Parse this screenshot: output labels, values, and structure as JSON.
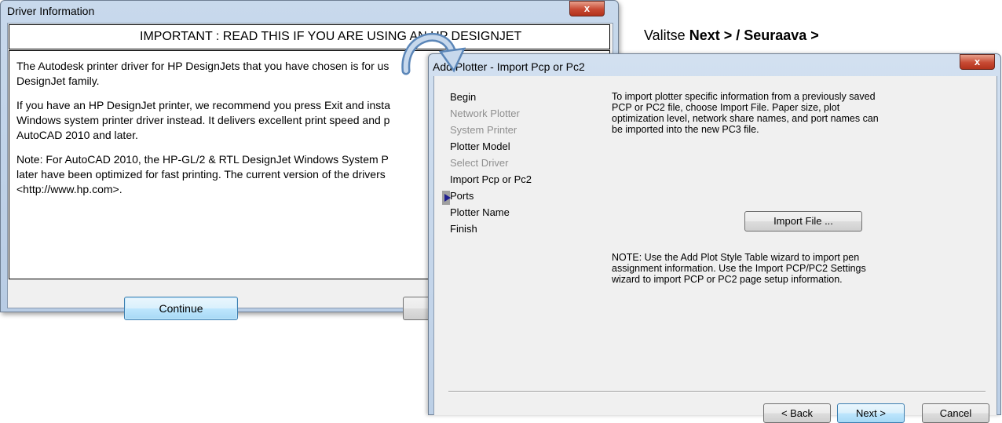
{
  "driver_window": {
    "title": "Driver Information",
    "close_label": "x",
    "header": "IMPORTANT : READ THIS IF YOU ARE USING AN HP DESIGNJET",
    "paragraphs": [
      "The Autodesk printer driver for HP DesignJets that you have chosen is for us\nDesignJet family.",
      "If you have an HP DesignJet printer, we recommend you press Exit and insta\nWindows system printer driver instead.  It delivers excellent print speed and p\nAutoCAD 2010 and later.",
      "Note: For AutoCAD 2010, the HP-GL/2 & RTL DesignJet Windows System P\nlater have been optimized for fast printing.  The current version of the drivers\n<http://www.hp.com>."
    ],
    "continue_label": "Continue"
  },
  "caption": {
    "prefix": "Valitse ",
    "bold": "Next > / Seuraava >"
  },
  "plotter_window": {
    "title": "Add Plotter - Import Pcp or Pc2",
    "close_label": "x",
    "steps": [
      {
        "label": "Begin",
        "enabled": true
      },
      {
        "label": "Network Plotter",
        "enabled": false
      },
      {
        "label": "System Printer",
        "enabled": false
      },
      {
        "label": "Plotter Model",
        "enabled": true
      },
      {
        "label": "Select Driver",
        "enabled": false
      },
      {
        "label": "Import Pcp or Pc2",
        "enabled": true,
        "current": true
      },
      {
        "label": "Ports",
        "enabled": true
      },
      {
        "label": "Plotter Name",
        "enabled": true
      },
      {
        "label": "Finish",
        "enabled": true
      }
    ],
    "intro": "To import plotter specific information from a previously saved\nPCP or PC2 file, choose Import File. Paper size, plot\noptimization level, network share names, and port names can\nbe imported into the new PC3 file.",
    "import_label": "Import File ...",
    "note": "NOTE: Use the Add Plot Style Table wizard to import pen\nassignment information. Use the Import PCP/PC2 Settings\nwizard to import PCP or PC2 page setup information.",
    "back_label": "< Back",
    "next_label": "Next >",
    "cancel_label": "Cancel"
  },
  "colors": {
    "accent": "#3c7fb1",
    "disabled_text": "#8f8f8f",
    "close_red": "#c74a33"
  }
}
